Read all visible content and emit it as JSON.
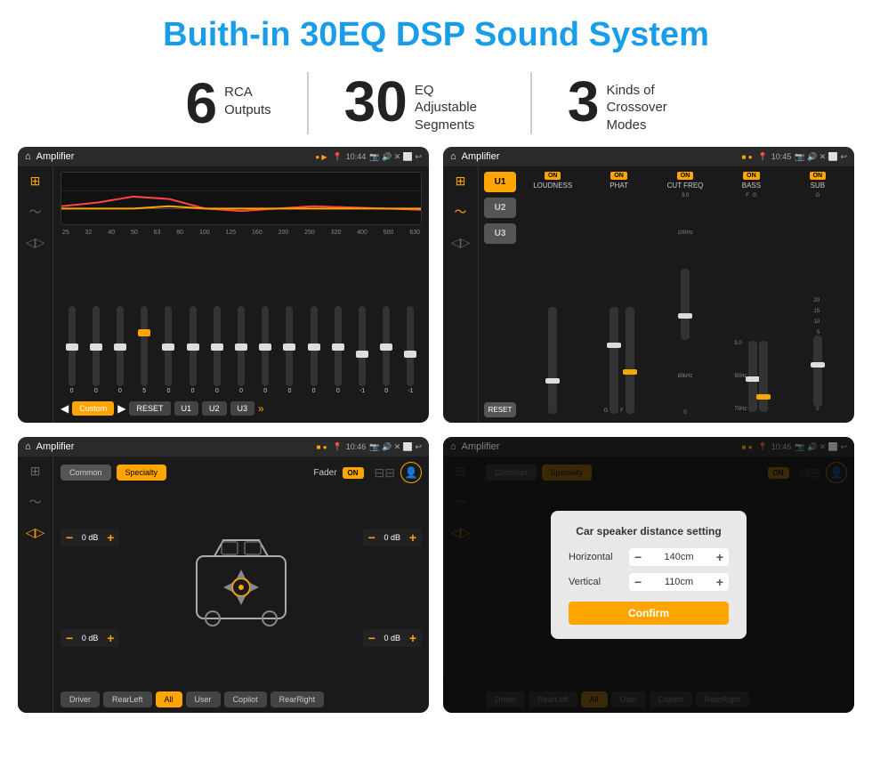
{
  "header": {
    "title": "Buith-in 30EQ DSP Sound System"
  },
  "stats": [
    {
      "number": "6",
      "text": "RCA\nOutputs"
    },
    {
      "number": "30",
      "text": "EQ Adjustable\nSegments"
    },
    {
      "number": "3",
      "text": "Kinds of\nCrossover Modes"
    }
  ],
  "screens": {
    "eq": {
      "title": "Amplifier",
      "time": "10:44",
      "frequencies": [
        "25",
        "32",
        "40",
        "50",
        "63",
        "80",
        "100",
        "125",
        "160",
        "200",
        "250",
        "320",
        "400",
        "500",
        "630"
      ],
      "values": [
        "0",
        "0",
        "0",
        "5",
        "0",
        "0",
        "0",
        "0",
        "0",
        "0",
        "0",
        "0",
        "-1",
        "0",
        "-1"
      ],
      "presets": [
        "Custom",
        "RESET",
        "U1",
        "U2",
        "U3"
      ]
    },
    "crossover": {
      "title": "Amplifier",
      "time": "10:45",
      "channels": [
        "LOUDNESS",
        "PHAT",
        "CUT FREQ",
        "BASS",
        "SUB"
      ],
      "uButtons": [
        "U1",
        "U2",
        "U3"
      ]
    },
    "fader": {
      "title": "Amplifier",
      "time": "10:46",
      "tabs": [
        "Common",
        "Specialty"
      ],
      "faderLabel": "Fader",
      "zones": {
        "topLeft": "0 dB",
        "topRight": "0 dB",
        "bottomLeft": "0 dB",
        "bottomRight": "0 dB"
      },
      "buttons": [
        "Driver",
        "RearLeft",
        "All",
        "User",
        "Copilot",
        "RearRight"
      ]
    },
    "dialog": {
      "title": "Amplifier",
      "time": "10:46",
      "dialogTitle": "Car speaker distance setting",
      "horizontal": {
        "label": "Horizontal",
        "value": "140cm"
      },
      "vertical": {
        "label": "Vertical",
        "value": "110cm"
      },
      "confirmLabel": "Confirm",
      "buttons": [
        "Driver",
        "RearLeft",
        "All",
        "User",
        "Copilot",
        "RearRight"
      ]
    }
  }
}
